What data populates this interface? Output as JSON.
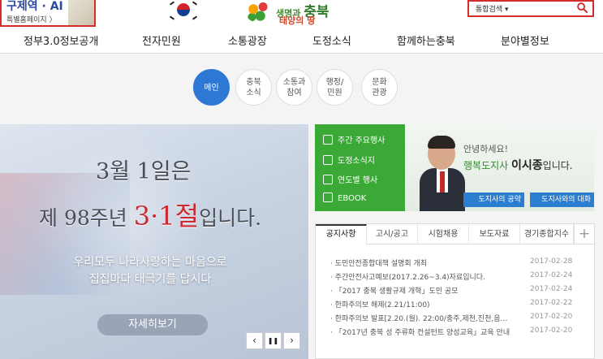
{
  "top": {
    "banner": {
      "title": "구제역 · AI",
      "sub": "특별홈페이지 〉"
    },
    "logo": {
      "line1a": "생명과 ",
      "line1b": "충북",
      "line2": "태양의 땅"
    },
    "search": {
      "select_label": "통합검색",
      "caret": "▾"
    }
  },
  "gnb": {
    "items": [
      "정부3.0정보공개",
      "전자민원",
      "소통광장",
      "도정소식",
      "함께하는충북",
      "분야별정보"
    ]
  },
  "quick": {
    "items": [
      {
        "line1": "메인",
        "line2": ""
      },
      {
        "line1": "충북",
        "line2": "소식"
      },
      {
        "line1": "소통과",
        "line2": "참여"
      },
      {
        "line1": "행정/",
        "line2": "민원"
      },
      {
        "line1": "문화",
        "line2": "관광"
      }
    ]
  },
  "visual": {
    "h1": "3월 1일은",
    "h2_pre": "제 98주년 ",
    "h2_red": "3·1절",
    "h2_post": "입니다.",
    "sub1": "우리모두 나라사랑하는 마음으로",
    "sub2": "집집마다 태극기를 답시다",
    "more": "자세히보기",
    "prev": "‹",
    "pause": "❚❚",
    "next": "›"
  },
  "shortcuts": {
    "items": [
      "주간 주요행사",
      "도정소식지",
      "연도별 행사",
      "EBOOK"
    ]
  },
  "governor": {
    "hello": "안녕하세요!",
    "title": "행복도지사 ",
    "name": "이시종",
    "suffix": "입니다.",
    "btn1": "도지사의 공약",
    "btn2": "도지사와의 대화"
  },
  "board": {
    "tabs": [
      "공지사항",
      "고시/공고",
      "시험채용",
      "보도자료",
      "경기종합지수"
    ],
    "plus": "+",
    "rows": [
      {
        "title": "· 도민안전종합대책 설명회 개최",
        "date": "2017-02-28"
      },
      {
        "title": "· 주간안전사고예보(2017.2.26~3.4)자료입니다.",
        "date": "2017-02-24"
      },
      {
        "title": "· 「2017 충북 생활규제 개혁」도민 공모",
        "date": "2017-02-24"
      },
      {
        "title": "· 한파주의보 해제(2.21/11:00)",
        "date": "2017-02-22"
      },
      {
        "title": "· 한파주의보 발표[2.20.(월). 22:00/충주,제천,진천,음…",
        "date": "2017-02-20"
      },
      {
        "title": "· 「2017년 충북 성 주류화 컨설턴트 양성교육」교육 안내",
        "date": "2017-02-20"
      }
    ]
  },
  "colors": {
    "accent_red": "#d42b2b",
    "nav_blue": "#2c78d4",
    "green": "#3aa935"
  }
}
